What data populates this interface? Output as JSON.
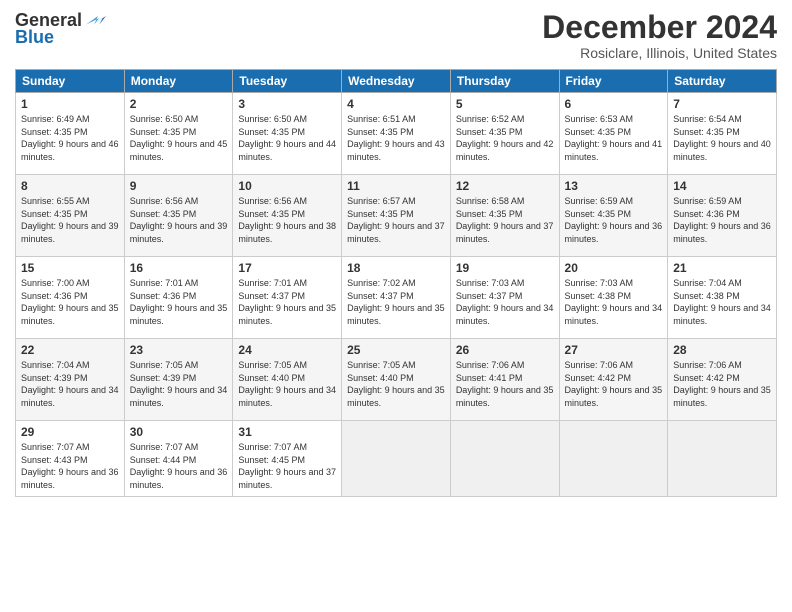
{
  "header": {
    "logo_general": "General",
    "logo_blue": "Blue",
    "month_title": "December 2024",
    "subtitle": "Rosiclare, Illinois, United States"
  },
  "columns": [
    "Sunday",
    "Monday",
    "Tuesday",
    "Wednesday",
    "Thursday",
    "Friday",
    "Saturday"
  ],
  "weeks": [
    [
      {
        "day": "1",
        "sunrise": "6:49 AM",
        "sunset": "4:35 PM",
        "daylight": "9 hours and 46 minutes."
      },
      {
        "day": "2",
        "sunrise": "6:50 AM",
        "sunset": "4:35 PM",
        "daylight": "9 hours and 45 minutes."
      },
      {
        "day": "3",
        "sunrise": "6:50 AM",
        "sunset": "4:35 PM",
        "daylight": "9 hours and 44 minutes."
      },
      {
        "day": "4",
        "sunrise": "6:51 AM",
        "sunset": "4:35 PM",
        "daylight": "9 hours and 43 minutes."
      },
      {
        "day": "5",
        "sunrise": "6:52 AM",
        "sunset": "4:35 PM",
        "daylight": "9 hours and 42 minutes."
      },
      {
        "day": "6",
        "sunrise": "6:53 AM",
        "sunset": "4:35 PM",
        "daylight": "9 hours and 41 minutes."
      },
      {
        "day": "7",
        "sunrise": "6:54 AM",
        "sunset": "4:35 PM",
        "daylight": "9 hours and 40 minutes."
      }
    ],
    [
      {
        "day": "8",
        "sunrise": "6:55 AM",
        "sunset": "4:35 PM",
        "daylight": "9 hours and 39 minutes."
      },
      {
        "day": "9",
        "sunrise": "6:56 AM",
        "sunset": "4:35 PM",
        "daylight": "9 hours and 39 minutes."
      },
      {
        "day": "10",
        "sunrise": "6:56 AM",
        "sunset": "4:35 PM",
        "daylight": "9 hours and 38 minutes."
      },
      {
        "day": "11",
        "sunrise": "6:57 AM",
        "sunset": "4:35 PM",
        "daylight": "9 hours and 37 minutes."
      },
      {
        "day": "12",
        "sunrise": "6:58 AM",
        "sunset": "4:35 PM",
        "daylight": "9 hours and 37 minutes."
      },
      {
        "day": "13",
        "sunrise": "6:59 AM",
        "sunset": "4:35 PM",
        "daylight": "9 hours and 36 minutes."
      },
      {
        "day": "14",
        "sunrise": "6:59 AM",
        "sunset": "4:36 PM",
        "daylight": "9 hours and 36 minutes."
      }
    ],
    [
      {
        "day": "15",
        "sunrise": "7:00 AM",
        "sunset": "4:36 PM",
        "daylight": "9 hours and 35 minutes."
      },
      {
        "day": "16",
        "sunrise": "7:01 AM",
        "sunset": "4:36 PM",
        "daylight": "9 hours and 35 minutes."
      },
      {
        "day": "17",
        "sunrise": "7:01 AM",
        "sunset": "4:37 PM",
        "daylight": "9 hours and 35 minutes."
      },
      {
        "day": "18",
        "sunrise": "7:02 AM",
        "sunset": "4:37 PM",
        "daylight": "9 hours and 35 minutes."
      },
      {
        "day": "19",
        "sunrise": "7:03 AM",
        "sunset": "4:37 PM",
        "daylight": "9 hours and 34 minutes."
      },
      {
        "day": "20",
        "sunrise": "7:03 AM",
        "sunset": "4:38 PM",
        "daylight": "9 hours and 34 minutes."
      },
      {
        "day": "21",
        "sunrise": "7:04 AM",
        "sunset": "4:38 PM",
        "daylight": "9 hours and 34 minutes."
      }
    ],
    [
      {
        "day": "22",
        "sunrise": "7:04 AM",
        "sunset": "4:39 PM",
        "daylight": "9 hours and 34 minutes."
      },
      {
        "day": "23",
        "sunrise": "7:05 AM",
        "sunset": "4:39 PM",
        "daylight": "9 hours and 34 minutes."
      },
      {
        "day": "24",
        "sunrise": "7:05 AM",
        "sunset": "4:40 PM",
        "daylight": "9 hours and 34 minutes."
      },
      {
        "day": "25",
        "sunrise": "7:05 AM",
        "sunset": "4:40 PM",
        "daylight": "9 hours and 35 minutes."
      },
      {
        "day": "26",
        "sunrise": "7:06 AM",
        "sunset": "4:41 PM",
        "daylight": "9 hours and 35 minutes."
      },
      {
        "day": "27",
        "sunrise": "7:06 AM",
        "sunset": "4:42 PM",
        "daylight": "9 hours and 35 minutes."
      },
      {
        "day": "28",
        "sunrise": "7:06 AM",
        "sunset": "4:42 PM",
        "daylight": "9 hours and 35 minutes."
      }
    ],
    [
      {
        "day": "29",
        "sunrise": "7:07 AM",
        "sunset": "4:43 PM",
        "daylight": "9 hours and 36 minutes."
      },
      {
        "day": "30",
        "sunrise": "7:07 AM",
        "sunset": "4:44 PM",
        "daylight": "9 hours and 36 minutes."
      },
      {
        "day": "31",
        "sunrise": "7:07 AM",
        "sunset": "4:45 PM",
        "daylight": "9 hours and 37 minutes."
      },
      null,
      null,
      null,
      null
    ]
  ]
}
